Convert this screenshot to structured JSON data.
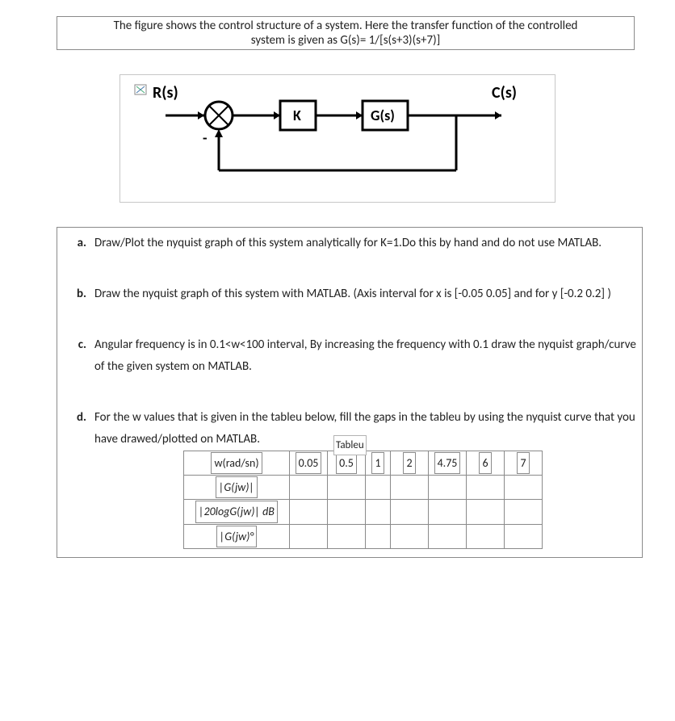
{
  "header": {
    "line1": "The figure shows the control structure of a system. Here the transfer function of the controlled",
    "line2": "system is given as G(s)=  1/[s(s+3)(s+7)]"
  },
  "diagram": {
    "R": "R(s)",
    "K": "K",
    "G": "G(s)",
    "C": "C(s)",
    "minus": "-"
  },
  "questions": {
    "a": {
      "label": "a.",
      "text": "Draw/Plot the nyquist graph of this system analytically for K=1.Do this by hand and do not use MATLAB."
    },
    "b": {
      "label": "b.",
      "text": "Draw the nyquist graph of this system with MATLAB. (Axis interval for  x is [-0.05 0.05] and for  y  [-0.2 0.2] )"
    },
    "c": {
      "label": "c.",
      "text": "Angular frequency is in 0.1<w<100 interval, By increasing the frequency with 0.1  draw the nyquist graph/curve of the given system on MATLAB."
    },
    "d": {
      "label": "d.",
      "text": "For the w values that is given in the tableu below, fill the gaps in the tableu by using the nyquist curve that you have drawed/plotted on MATLAB."
    }
  },
  "tableu": {
    "caption": "Tableu",
    "rows": {
      "r1": "w(rad/sn)",
      "r2": "|G(jw)|",
      "r3": "|20logG(jw)| dB",
      "r4": "|G(jw)°"
    },
    "cols": [
      "0.05",
      "0.5",
      "1",
      "2",
      "4.75",
      "6",
      "7"
    ]
  }
}
